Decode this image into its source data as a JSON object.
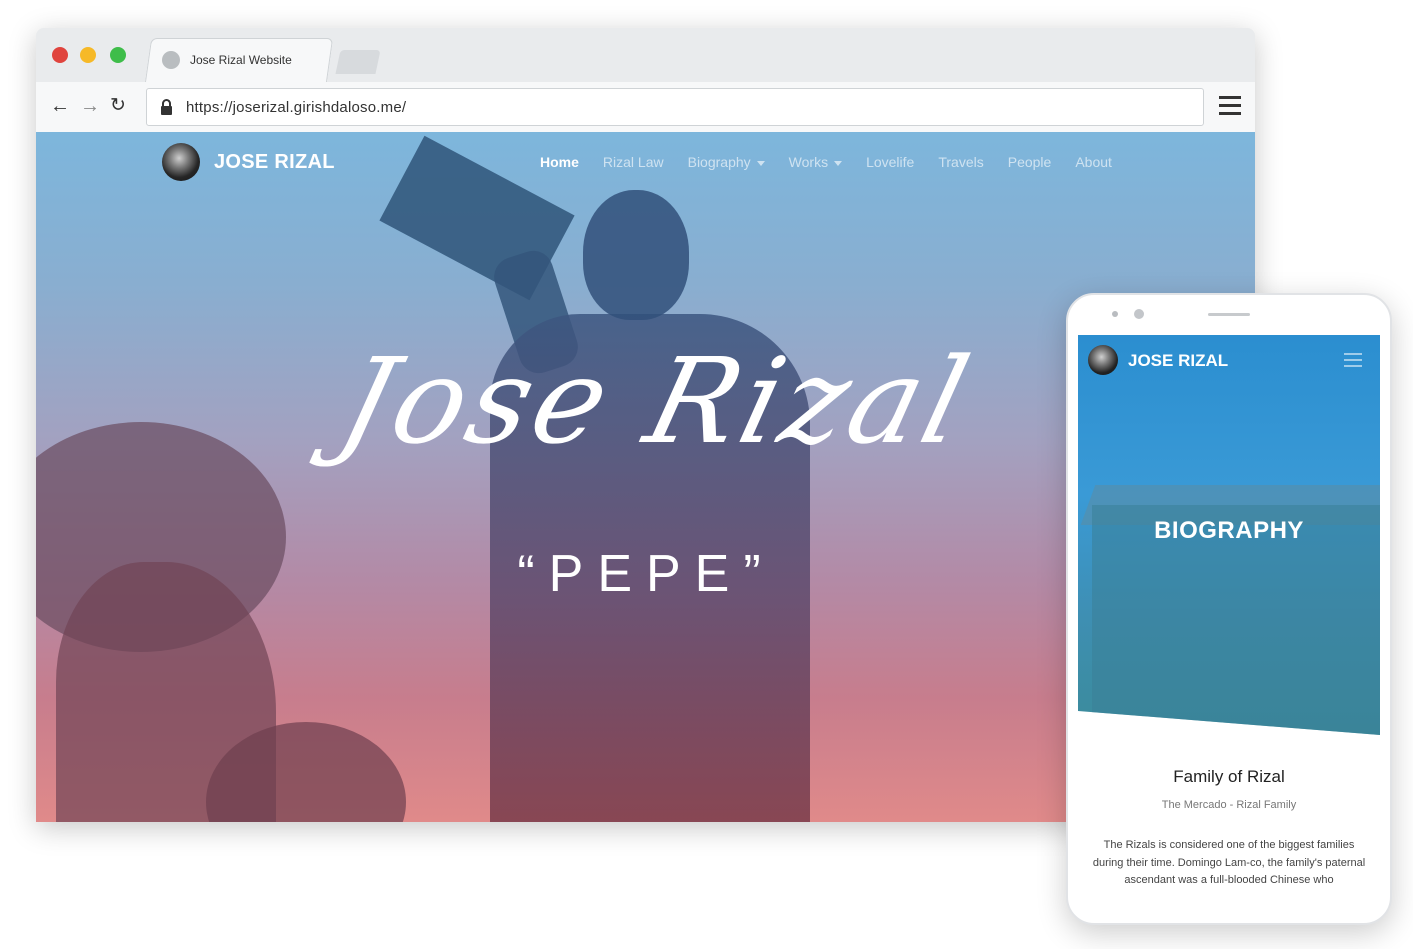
{
  "browser": {
    "tab_title": "Jose Rizal Website",
    "url_prefix": "https://",
    "url_host": "joserizal.girishdaloso.me/"
  },
  "site": {
    "brand": "JOSE RIZAL",
    "nav": [
      {
        "label": "Home",
        "active": true
      },
      {
        "label": "Rizal Law"
      },
      {
        "label": "Biography",
        "dropdown": true
      },
      {
        "label": "Works",
        "dropdown": true
      },
      {
        "label": "Lovelife"
      },
      {
        "label": "Travels"
      },
      {
        "label": "People"
      },
      {
        "label": "About"
      }
    ],
    "hero_title": "Jose Rizal",
    "hero_subtitle": "“PEPE”"
  },
  "mobile": {
    "brand": "JOSE RIZAL",
    "hero_title": "BIOGRAPHY",
    "heading": "Family of Rizal",
    "subheading": "The Mercado - Rizal Family",
    "body": "The Rizals is considered one of the biggest families during their time. Domingo Lam-co, the family's paternal ascendant was a full-blooded Chinese who"
  },
  "icons": {
    "back": "arrow-left-icon",
    "forward": "arrow-right-icon",
    "reload": "reload-icon",
    "lock": "lock-icon",
    "menu": "hamburger-menu-icon"
  },
  "colors": {
    "accent_blue": "#7db6dc",
    "accent_pink": "#e08a8a",
    "mobile_blue": "#2b8ed0"
  }
}
